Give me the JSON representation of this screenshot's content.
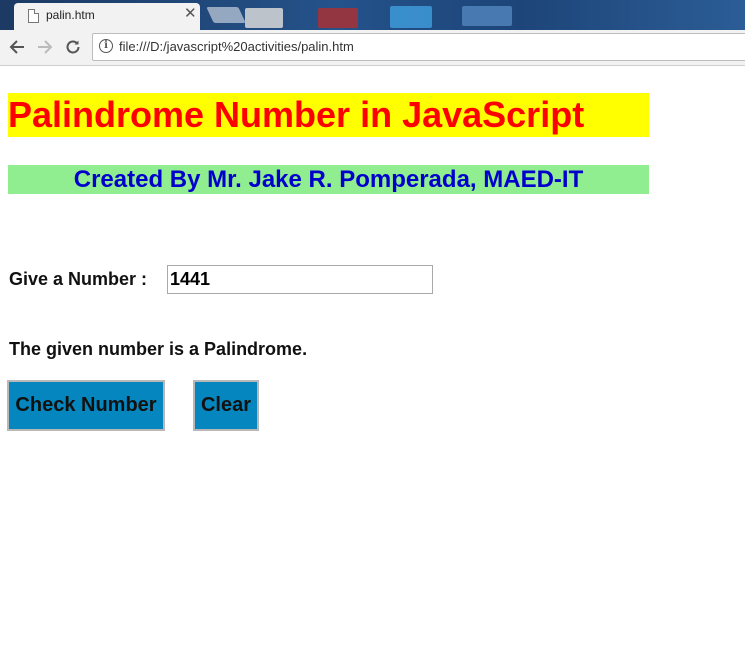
{
  "browser": {
    "tab_title": "palin.htm",
    "tab_close_icon": "close-icon",
    "address_url": "file:///D:/javascript%20activities/palin.htm",
    "icons": [
      "back-arrow-icon",
      "forward-arrow-icon",
      "reload-icon",
      "info-icon",
      "page-icon"
    ]
  },
  "page": {
    "title": "Palindrome Number in JavaScript",
    "author_line": "Created By Mr. Jake R. Pomperada, MAED-IT",
    "input_label": "Give a Number :",
    "input_value": "1441",
    "result_text": "The given number is a Palindrome.",
    "check_button_label": "Check Number",
    "clear_button_label": "Clear"
  },
  "colors": {
    "title_background": "#ffff00",
    "title_text": "#ff0000",
    "author_background": "#90ee90",
    "author_text": "#0000cd",
    "button_background": "#0586be"
  }
}
